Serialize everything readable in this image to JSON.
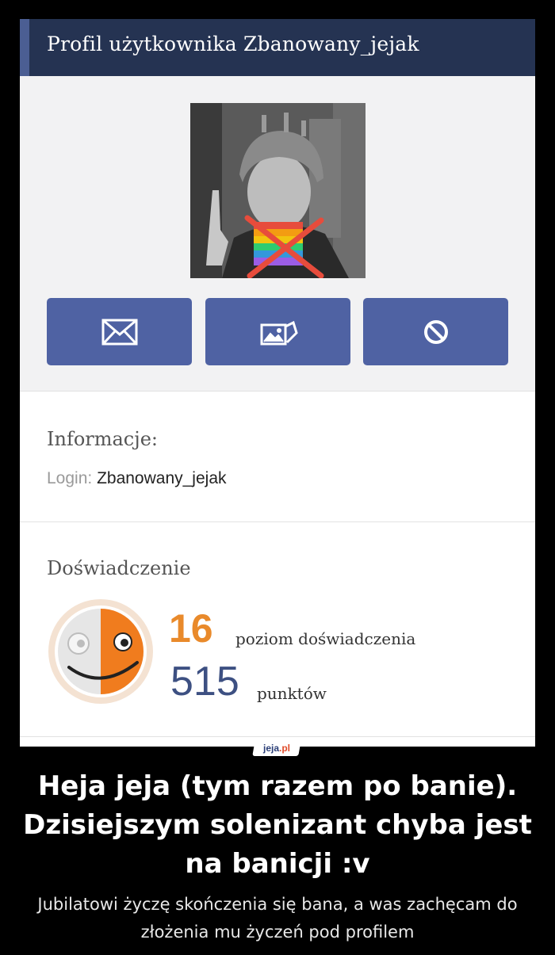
{
  "header": {
    "title": "Profil użytkownika Zbanowany_jejak"
  },
  "actions": {
    "message_icon": "envelope-icon",
    "gallery_icon": "gallery-icon",
    "ban_icon": "ban-icon"
  },
  "info": {
    "title": "Informacje:",
    "login_label": "Login:",
    "login_value": "Zbanowany_jejak"
  },
  "experience": {
    "title": "Doświadczenie",
    "level": "16",
    "level_label": "poziom doświadczenia",
    "points": "515",
    "points_label": "punktów",
    "badge_fill_fraction": 0.5
  },
  "watermark": {
    "brand": "jeja",
    "domain_suffix": ".pl"
  },
  "caption": {
    "title": "Heja jeja (tym razem po banie). Dzisiejszym solenizant chyba jest na banicji :v",
    "subtitle": "Jubilatowi życzę skończenia się bana, a was zachęcam do złożenia mu życzeń pod profilem"
  },
  "colors": {
    "header_bg": "#253352",
    "button_bg": "#4f62a3",
    "level_color": "#e98a2b",
    "points_color": "#3d5082"
  }
}
